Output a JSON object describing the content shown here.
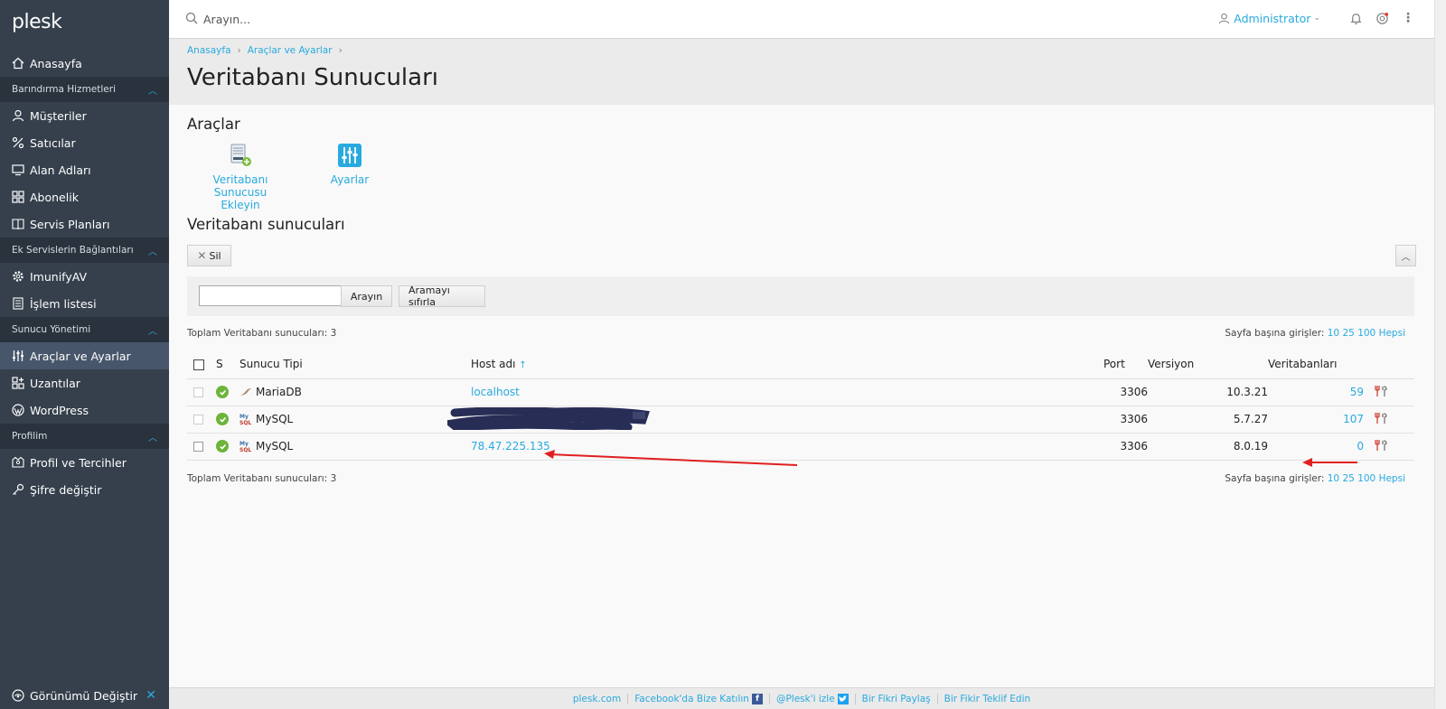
{
  "brand": {
    "logo_text": "plesk"
  },
  "search": {
    "placeholder": "Arayın..."
  },
  "user": {
    "name": "Administrator"
  },
  "sidebar": {
    "home": "Anasayfa",
    "groups": [
      {
        "title": "Barındırma Hizmetleri",
        "items": [
          "Müşteriler",
          "Satıcılar",
          "Alan Adları",
          "Abonelik",
          "Servis Planları"
        ]
      },
      {
        "title": "Ek Servislerin Bağlantıları",
        "items": [
          "ImunifyAV",
          "İşlem listesi"
        ]
      },
      {
        "title": "Sunucu Yönetimi",
        "items": [
          "Araçlar ve Ayarlar",
          "Uzantılar",
          "WordPress"
        ]
      },
      {
        "title": "Profilim",
        "items": [
          "Profil ve Tercihler",
          "Şifre değiştir"
        ]
      }
    ],
    "bottom": "Görünümü Değiştir"
  },
  "breadcrumb": [
    "Anasayfa",
    "Araçlar ve Ayarlar"
  ],
  "page_title": "Veritabanı Sunucuları",
  "tools": {
    "title": "Araçlar",
    "add_server_line1": "Veritabanı Sunucusu",
    "add_server_line2": "Ekleyin",
    "settings": "Ayarlar"
  },
  "servers_section": {
    "title": "Veritabanı sunucuları",
    "delete_btn": "Sil",
    "search_btn": "Arayın",
    "reset_btn": "Aramayı sıfırla",
    "search_value": "",
    "total": "Toplam Veritabanı sunucuları: 3",
    "per_page_label": "Sayfa başına girişler:",
    "per_page_options": [
      "10",
      "25",
      "100",
      "Hepsi"
    ]
  },
  "table": {
    "columns": {
      "status": "S",
      "type": "Sunucu Tipi",
      "host": "Host adı",
      "port": "Port",
      "version": "Versiyon",
      "databases": "Veritabanları"
    },
    "sort_indicator": "↑",
    "rows": [
      {
        "type": "MariaDB",
        "host": "localhost",
        "port": "3306",
        "version": "10.3.21",
        "databases": "59"
      },
      {
        "type": "MySQL",
        "host": "",
        "port": "3306",
        "version": "5.7.27",
        "databases": "107"
      },
      {
        "type": "MySQL",
        "host": "78.47.225.135",
        "port": "3306",
        "version": "8.0.19",
        "databases": "0"
      }
    ]
  },
  "footer": [
    "plesk.com",
    "Facebook'da Bize Katılın",
    "@Plesk'i izle",
    "Bir Fikri Paylaş",
    "Bir Fikir Teklif Edin"
  ],
  "colors": {
    "accent": "#28aade",
    "sidebar": "#35404c",
    "status_ok": "#6cb43a",
    "annotation": "#e02020"
  }
}
